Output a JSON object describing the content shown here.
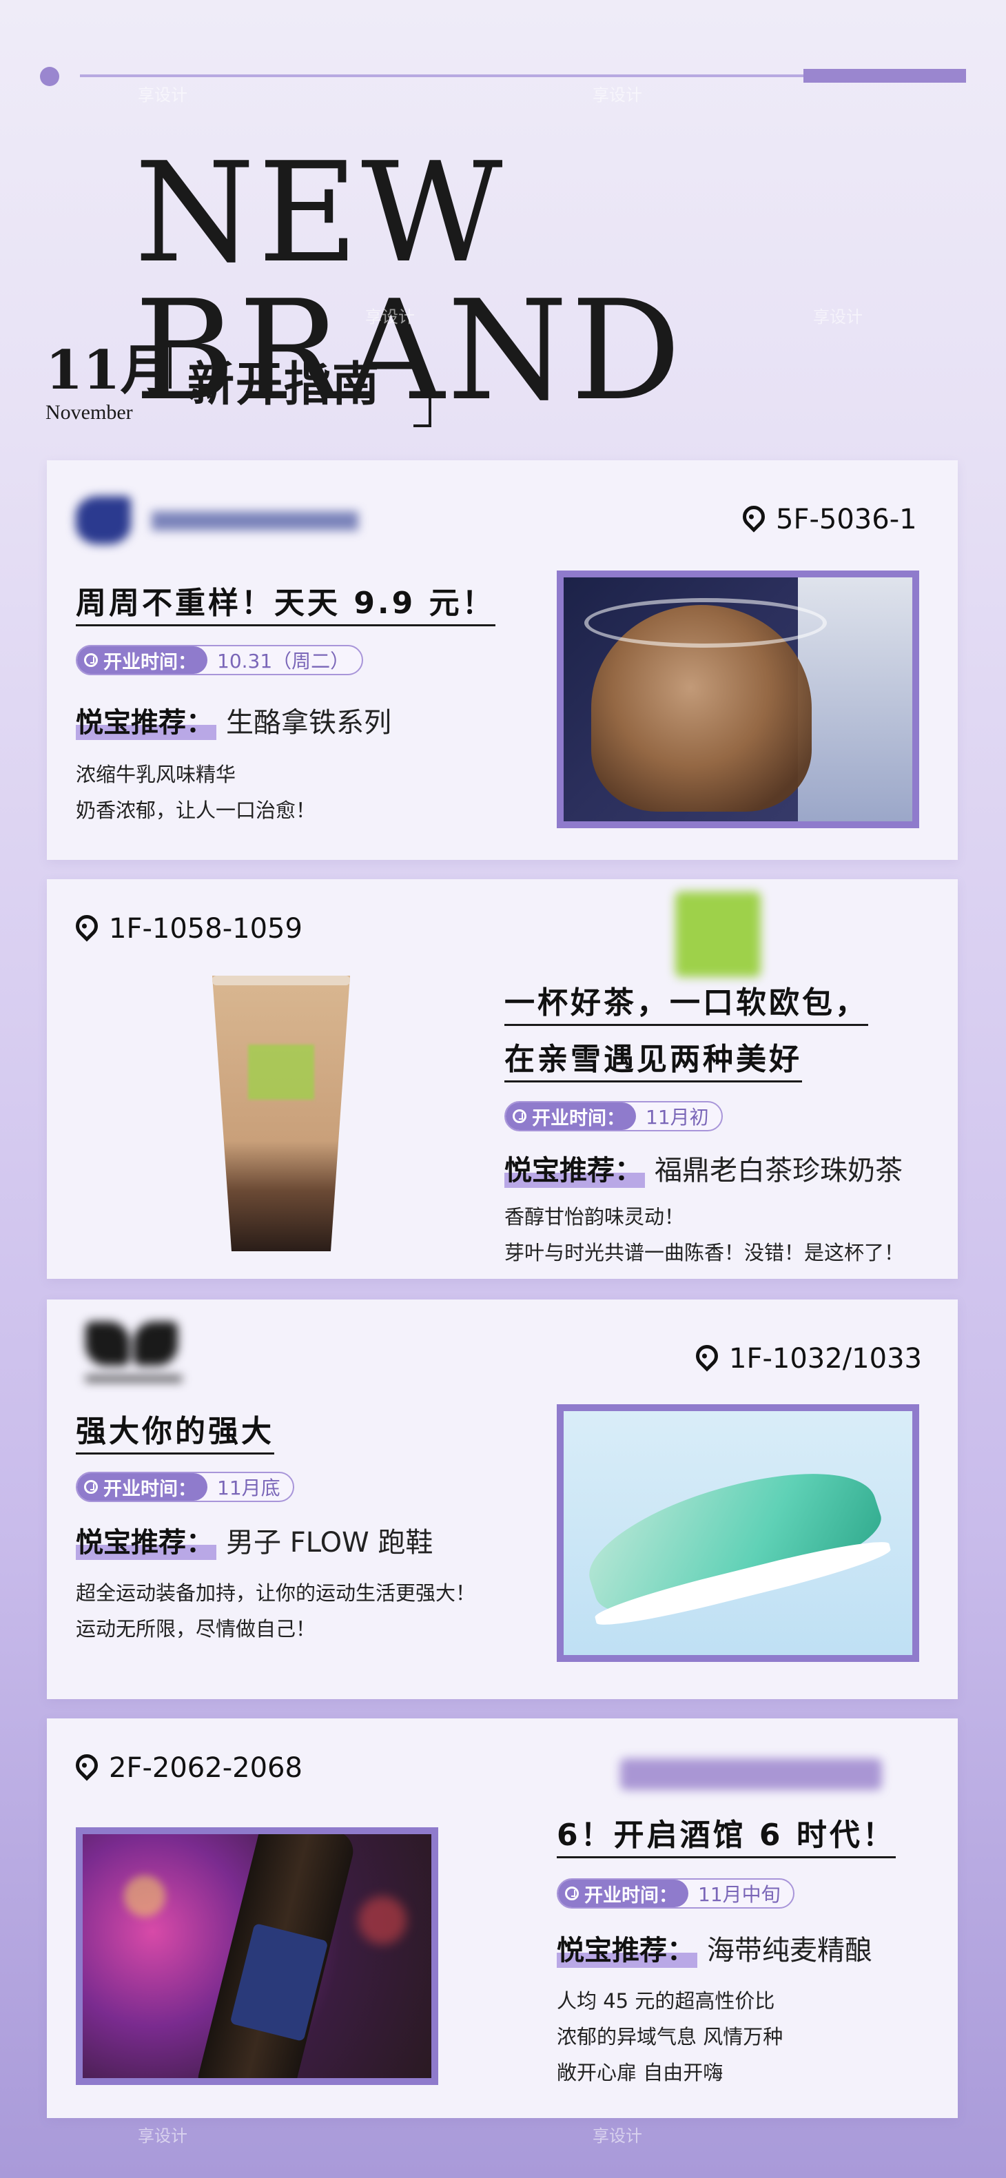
{
  "header": {
    "title": "NEW BRAND",
    "month": "11月",
    "month_en": "November",
    "guide_title": "新开指南"
  },
  "cards": [
    {
      "logo_text": "luckin coffee",
      "location": "5F-5036-1",
      "headline_lines": [
        "周周不重样！天天 9.9 元！"
      ],
      "open_label": "开业时间：",
      "open_time": "10.31（周二）",
      "rec_label": "悦宝推荐：",
      "rec_value": "生酪拿铁系列",
      "desc_lines": [
        "浓缩牛乳风味精华",
        "奶香浓郁，让人一口治愈！"
      ]
    },
    {
      "location": "1F-1058-1059",
      "headline_lines": [
        "一杯好茶，一口软欧包，",
        "在亲雪遇见两种美好"
      ],
      "open_label": "开业时间：",
      "open_time": "11月初",
      "rec_label": "悦宝推荐：",
      "rec_value": "福鼎老白茶珍珠奶茶",
      "desc_lines": [
        "香醇甘怡韵味灵动！",
        "芽叶与时光共谱一曲陈香！没错！是这杯了！"
      ]
    },
    {
      "location": "1F-1032/1033",
      "headline_lines": [
        "强大你的强大"
      ],
      "open_label": "开业时间：",
      "open_time": "11月底",
      "rec_label": "悦宝推荐：",
      "rec_value": "男子 FLOW 跑鞋",
      "desc_lines": [
        "超全运动装备加持，让你的运动生活更强大！",
        "运动无所限，尽情做自己！"
      ]
    },
    {
      "location": "2F-2062-2068",
      "headline_lines": [
        "6！开启酒馆 6 时代！"
      ],
      "open_label": "开业时间：",
      "open_time": "11月中旬",
      "rec_label": "悦宝推荐：",
      "rec_value": "海带纯麦精酿",
      "desc_lines": [
        "人均 45 元的超高性价比",
        "浓郁的异域气息 风情万种",
        "敞开心扉 自由开嗨"
      ]
    }
  ],
  "watermark": "享设计",
  "colors": {
    "accent": "#8f7bcc",
    "accent_light": "#b7a9e1",
    "card_bg": "#f4f2fb"
  }
}
